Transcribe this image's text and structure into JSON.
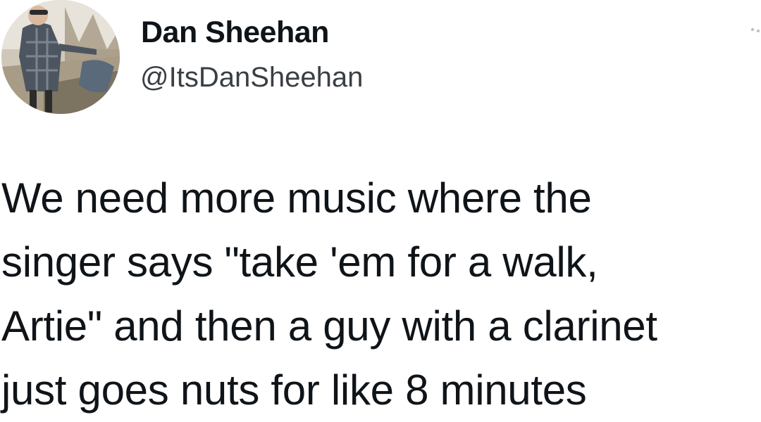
{
  "tweet": {
    "author": {
      "name": "Dan Sheehan",
      "handle": "@ItsDanSheehan"
    },
    "text_lines": [
      "We need more music where the",
      "singer says \"take 'em for a walk,",
      "Artie\" and then a guy with a clarinet",
      "just goes nuts for like 8 minutes"
    ],
    "more_icon": "more-horizontal-icon"
  }
}
